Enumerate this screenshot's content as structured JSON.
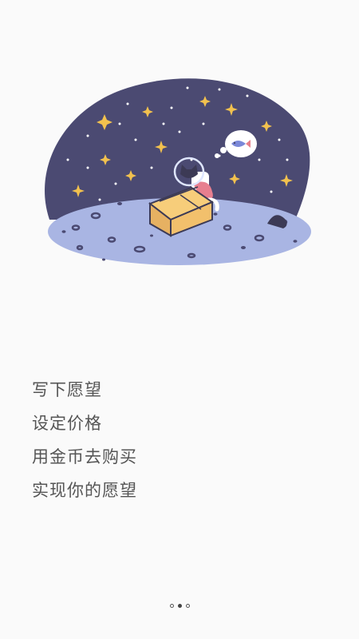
{
  "colors": {
    "background": "#fafafa",
    "sky": "#4b4a72",
    "ground": "#a9b5e3",
    "star": "#f2c14e",
    "text": "#555555"
  },
  "illustration": {
    "name": "astronaut-cat-with-box-illustration"
  },
  "steps": [
    {
      "label": "写下愿望"
    },
    {
      "label": "设定价格"
    },
    {
      "label": "用金币去购买"
    },
    {
      "label": "实现你的愿望"
    }
  ],
  "pager": {
    "count": 3,
    "active_index": 1
  }
}
